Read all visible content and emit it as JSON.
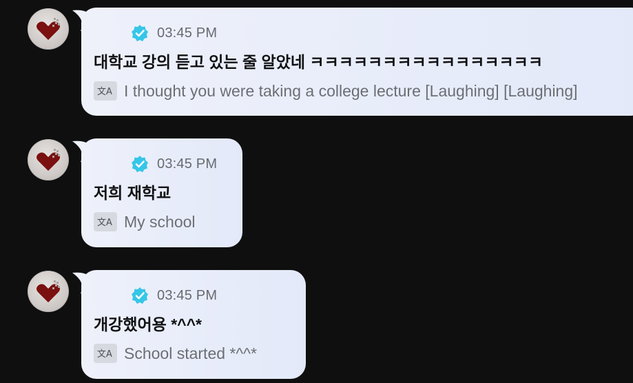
{
  "messages": [
    {
      "time": "03:45 PM",
      "original": "대학교 강의 듣고 있는 줄 알았네 ㅋㅋㅋㅋㅋㅋㅋㅋㅋㅋㅋㅋㅋㅋㅋㅋ",
      "translation": "I thought you were taking a college lecture [Laughing] [Laughing]"
    },
    {
      "time": "03:45 PM",
      "original": "저희 재학교",
      "translation": "My school"
    },
    {
      "time": "03:45 PM",
      "original": "개강했어용 *^^*",
      "translation": "School started *^^*"
    }
  ],
  "icons": {
    "verified": "verified-badge-icon",
    "translate": "translate-icon",
    "avatar": "heart-avatar-icon"
  },
  "colors": {
    "background": "#0f0f10",
    "bubble": "#e8edf9",
    "verified": "#36c6e8",
    "time": "#666a70",
    "translation": "#6b6f75"
  }
}
